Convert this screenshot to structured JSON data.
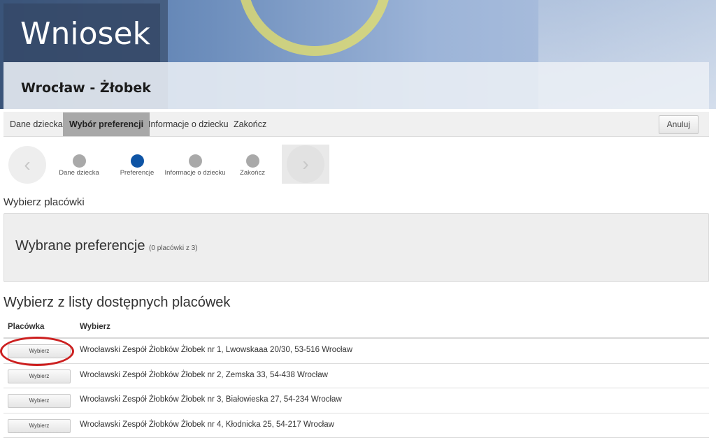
{
  "header": {
    "title": "Wniosek",
    "subtitle": "Wrocław - Żłobek"
  },
  "tabs": [
    {
      "label": "Dane dziecka",
      "active": false
    },
    {
      "label": "Wybór preferencji",
      "active": true
    },
    {
      "label": "Informacje o dziecku",
      "active": false
    },
    {
      "label": "Zakończ",
      "active": false
    }
  ],
  "cancel_label": "Anuluj",
  "stepper": {
    "prev_icon": "chevron-left-icon",
    "next_icon": "chevron-right-icon",
    "prev_glyph": "‹",
    "next_glyph": "›",
    "steps": [
      {
        "label": "Dane dziecka",
        "current": false
      },
      {
        "label": "Preferencje",
        "current": true
      },
      {
        "label": "Informacje o dziecku",
        "current": false
      },
      {
        "label": "Zakończ",
        "current": false
      }
    ]
  },
  "section_label": "Wybierz placówki",
  "preferences": {
    "title": "Wybrane preferencje",
    "count": "(0 placówki z 3)"
  },
  "list": {
    "title": "Wybierz z listy dostępnych placówek",
    "headers": [
      "Placówka",
      "Wybierz"
    ],
    "button_label": "Wybierz",
    "rows": [
      {
        "name": "Wrocławski Zespół Żłobków Żłobek nr 1, Lwowskaaa 20/30, 53-516 Wrocław"
      },
      {
        "name": "Wrocławski Zespół Żłobków Żłobek nr 2, Zemska 33, 54-438 Wrocław"
      },
      {
        "name": "Wrocławski Zespół Żłobków Żłobek nr 3, Białowieska 27, 54-234 Wrocław"
      },
      {
        "name": "Wrocławski Zespół Żłobków Żłobek nr 4, Kłodnicka 25, 54-217 Wrocław"
      }
    ]
  },
  "colors": {
    "active_step": "#0e54a5",
    "inactive_step": "#a9a9a9",
    "highlight": "#cc1f1f",
    "active_tab": "#a8a8a8"
  }
}
